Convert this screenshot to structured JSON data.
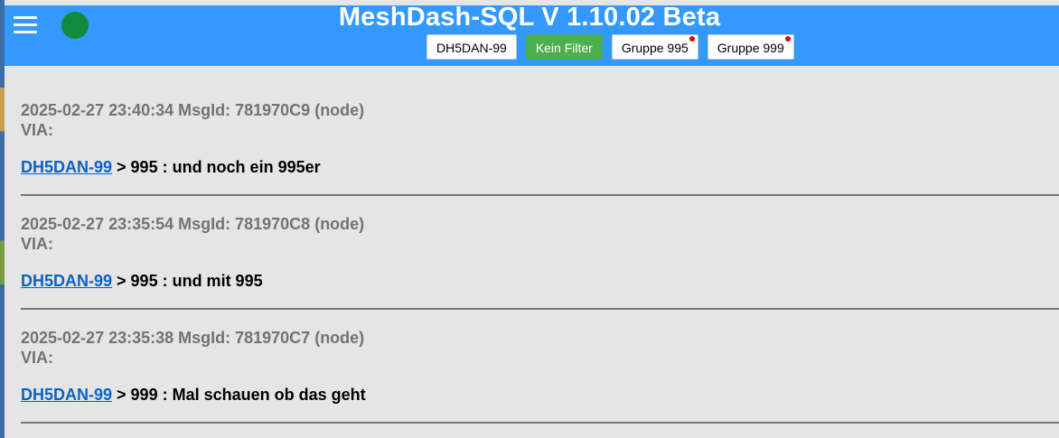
{
  "header": {
    "title": "MeshDash-SQL V 1.10.02 Beta",
    "status_color": "#118a3c",
    "accent_color": "#3399ff"
  },
  "filters": [
    {
      "label": "DH5DAN-99",
      "active": false,
      "unread": false
    },
    {
      "label": "Kein Filter",
      "active": true,
      "unread": false
    },
    {
      "label": "Gruppe 995",
      "active": false,
      "unread": true
    },
    {
      "label": "Gruppe 999",
      "active": false,
      "unread": true
    }
  ],
  "messages": [
    {
      "meta": "2025-02-27 23:40:34 MsgId: 781970C9 (node)",
      "via": "VIA:",
      "sender": "DH5DAN-99",
      "text": " > 995 : und noch ein 995er"
    },
    {
      "meta": "2025-02-27 23:35:54 MsgId: 781970C8 (node)",
      "via": "VIA:",
      "sender": "DH5DAN-99",
      "text": " > 995 : und mit 995"
    },
    {
      "meta": "2025-02-27 23:35:38 MsgId: 781970C7 (node)",
      "via": "VIA:",
      "sender": "DH5DAN-99",
      "text": " > 999 : Mal schauen ob das geht"
    }
  ]
}
